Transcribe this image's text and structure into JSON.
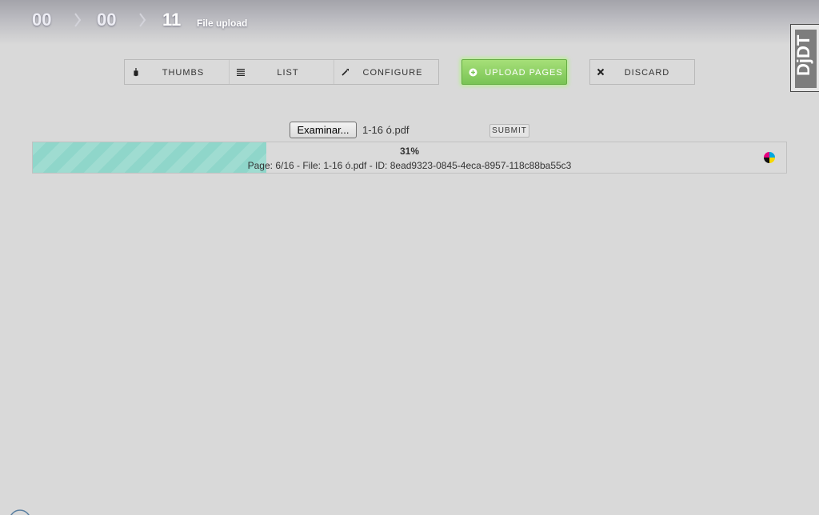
{
  "breadcrumb": {
    "steps": [
      {
        "value": "00"
      },
      {
        "value": "00"
      },
      {
        "value": "11"
      }
    ],
    "title": "File upload"
  },
  "logo": {
    "text": "DjDT"
  },
  "toolbar": {
    "thumbs": {
      "label": "THUMBS",
      "icon": "thumbs-icon"
    },
    "list": {
      "label": "LIST",
      "icon": "list-icon"
    },
    "configure": {
      "label": "CONFIGURE",
      "icon": "wrench-icon"
    },
    "upload": {
      "label": "UPLOAD PAGES",
      "icon": "plus-circle-icon"
    },
    "discard": {
      "label": "DISCARD",
      "icon": "close-icon"
    }
  },
  "upload_form": {
    "browse_label": "Examinar...",
    "file_name": "1-16 ó.pdf",
    "submit_label": "SUBMIT"
  },
  "progress": {
    "value": 0.31,
    "percent_label": "31%",
    "detail": "Page: 6/16 - File: 1-16 ó.pdf - ID: 8ead9323-0845-4eca-8957-118c88ba55c3",
    "icon": "color-wheel-icon"
  },
  "colors": {
    "progress_fill": "#8fd6ca",
    "upload_button": "#79c455",
    "background": "#d9d9d9"
  }
}
